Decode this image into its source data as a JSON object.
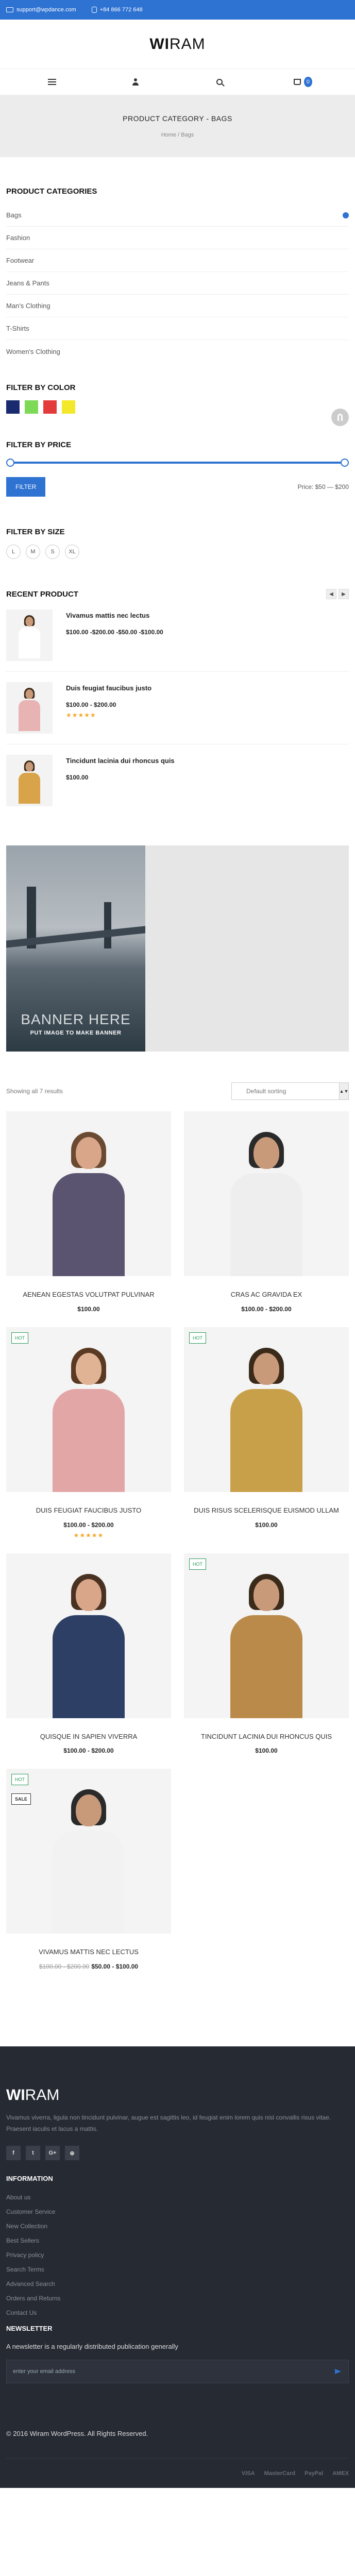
{
  "topbar": {
    "email": "support@wpdance.com",
    "phone": "+84 866 772 648",
    "bg_color": "#2e72d2"
  },
  "brand": {
    "logo_bold": "WI",
    "logo_light": "RAM"
  },
  "nav": {
    "menu_icon": "hamburger-icon",
    "account_icon": "user-icon",
    "search_icon": "search-icon",
    "cart_icon": "cart-icon",
    "cart_count": "0"
  },
  "page_header": {
    "title": "PRODUCT CATEGORY - BAGS",
    "breadcrumb": "Home / Bags"
  },
  "categories": {
    "title": "PRODUCT CATEGORIES",
    "items": [
      "Bags",
      "Fashion",
      "Footwear",
      "Jeans & Pants",
      "Man's Clothing",
      "T-Shirts",
      "Women's Clothing"
    ]
  },
  "color_filter": {
    "title": "FILTER BY COLOR",
    "colors": [
      "#1a2a6e",
      "#7ed957",
      "#e33b3b",
      "#f3e82a"
    ]
  },
  "price_filter": {
    "title": "FILTER BY PRICE",
    "button": "FILTER",
    "label": "Price: $50 — $200",
    "range_min_fraction": 0.0,
    "range_max_fraction": 1.0
  },
  "size_filter": {
    "title": "FILTER BY SIZE",
    "sizes": [
      "L",
      "M",
      "S",
      "XL"
    ]
  },
  "recent": {
    "title": "RECENT PRODUCT",
    "items": [
      {
        "name": "Vivamus mattis nec lectus",
        "price": "$100.00 -$200.00 -$50.00 -$100.00",
        "rating": "",
        "shirt": "#ffffff",
        "sleeve": "#5a4a6a"
      },
      {
        "name": "Duis feugiat faucibus justo",
        "price": "$100.00 - $200.00",
        "rating": "★★★★★",
        "shirt": "#e8b3b3",
        "sleeve": "#e8b3b3"
      },
      {
        "name": "Tincidunt lacinia dui rhoncus quis",
        "price": "$100.00",
        "rating": "",
        "shirt": "#d9a34a",
        "sleeve": "#6a4a2a"
      }
    ]
  },
  "banner": {
    "title": "BANNER HERE",
    "subtitle": "PUT IMAGE TO MAKE BANNER"
  },
  "shop": {
    "showing": "Showing all 7 results",
    "sort_label": "Default sorting"
  },
  "products": [
    {
      "name": "AENEAN EGESTAS VOLUTPAT PULVINAR",
      "price": "$100.00",
      "old_price": "",
      "tag": "",
      "sale": "",
      "rating": "",
      "top": "#5b5470",
      "skin": "#d9a68a",
      "hair": "#6b4a32"
    },
    {
      "name": "CRAS AC GRAVIDA EX",
      "price": "$100.00 - $200.00",
      "old_price": "",
      "tag": "",
      "sale": "",
      "rating": "",
      "top": "#eeeeee",
      "skin": "#c89a7a",
      "hair": "#2a2a2a"
    },
    {
      "name": "DUIS FEUGIAT FAUCIBUS JUSTO",
      "price": "$100.00 - $200.00",
      "old_price": "",
      "tag": "HOT",
      "sale": "",
      "rating": "★★★★★",
      "top": "#e3a6a6",
      "skin": "#e0b394",
      "hair": "#5a3a22"
    },
    {
      "name": "DUIS RISUS SCELERISQUE EUISMOD ULLAM",
      "price": "$100.00",
      "old_price": "",
      "tag": "HOT",
      "sale": "",
      "rating": "",
      "top": "#c8a04a",
      "skin": "#c89a7a",
      "hair": "#3a2a1a"
    },
    {
      "name": "QUISQUE IN SAPIEN VIVERRA",
      "price": "$100.00 - $200.00",
      "old_price": "",
      "tag": "",
      "sale": "",
      "rating": "",
      "top": "#2e3f66",
      "skin": "#d9a68a",
      "hair": "#4a3222"
    },
    {
      "name": "TINCIDUNT LACINIA DUI RHONCUS QUIS",
      "price": "$100.00",
      "old_price": "",
      "tag": "HOT",
      "sale": "",
      "rating": "",
      "top": "#b98a4a",
      "skin": "#c89a7a",
      "hair": "#3a2a1a"
    },
    {
      "name": "VIVAMUS MATTIS NEC LECTUS",
      "price": "$50.00 - $100.00",
      "old_price": "$100.00 - $200.00",
      "tag": "HOT",
      "sale": "SALE",
      "rating": "",
      "top": "#f2f2f2",
      "skin": "#c89a7a",
      "hair": "#2a2a2a"
    }
  ],
  "footer": {
    "logo_bold": "WI",
    "logo_light": "RAM",
    "about": "Vivamus viverra, ligula non tincidunt pulvinar, augue est sagittis leo, id feugiat enim lorem quis nisl convallis risus vitae. Praesent iaculis et lacus a mattis.",
    "social": [
      "f",
      "t",
      "G+",
      "⊕"
    ],
    "info_title": "INFORMATION",
    "links_a": [
      "About us",
      "Customer Service",
      "New Collection",
      "Best Sellers",
      "Privacy policy"
    ],
    "links_b": [
      "Search Terms",
      "Advanced Search",
      "Orders and Returns",
      "Contact Us"
    ],
    "newsletter_title": "NEWSLETTER",
    "newsletter_desc": "A newsletter is a regularly distributed publication generally",
    "email_placeholder": "enter your email address",
    "copyright": "© 2016 Wiram WordPress. All Rights Reserved.",
    "payments": [
      "VISA",
      "MasterCard",
      "PayPal",
      "AMEX"
    ]
  }
}
